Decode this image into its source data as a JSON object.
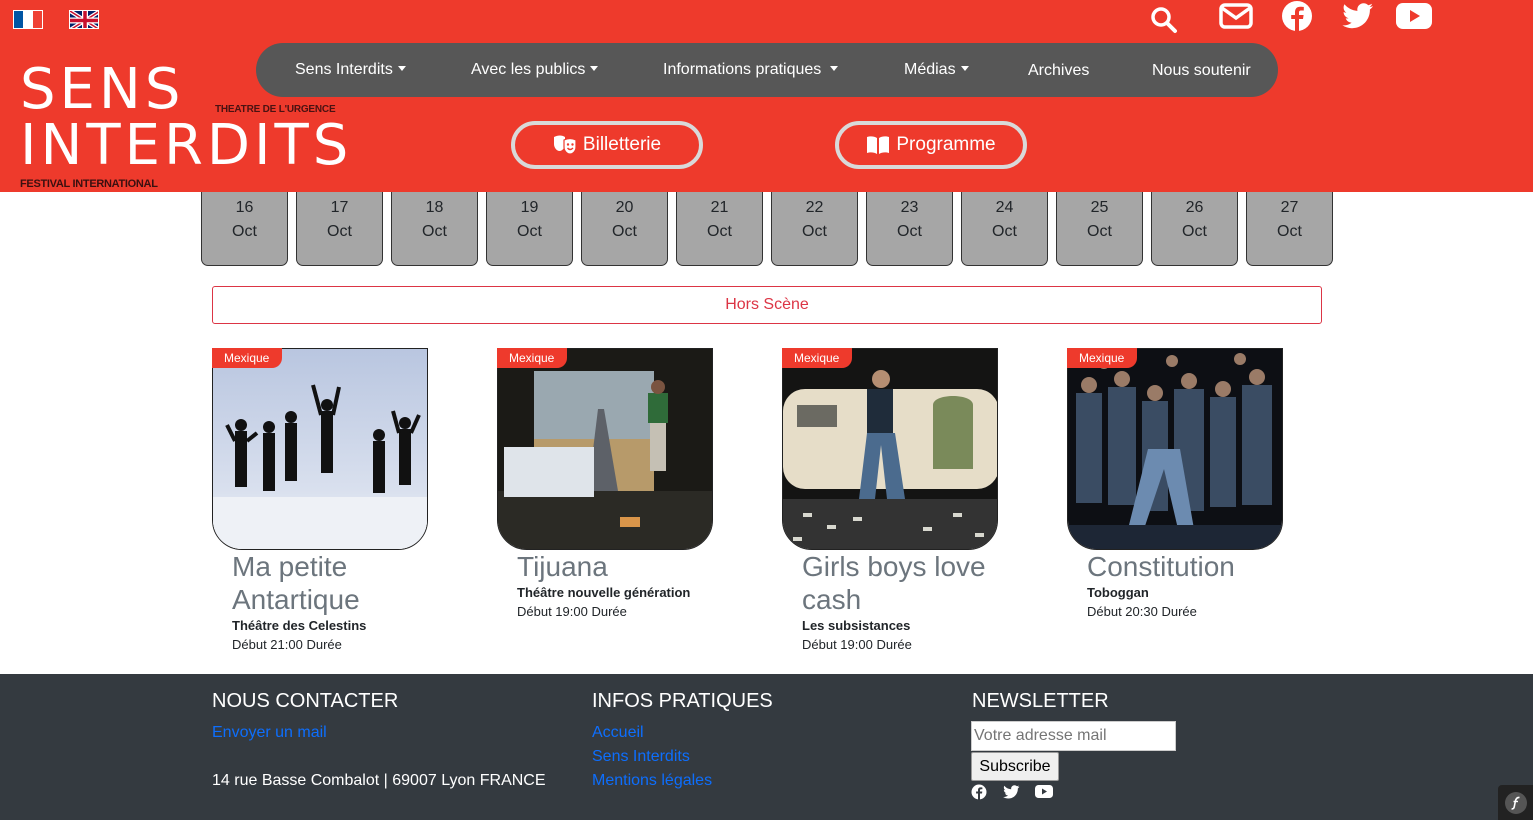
{
  "header": {
    "languages": [
      {
        "code": "fr",
        "icon": "flag-fr-icon"
      },
      {
        "code": "en",
        "icon": "flag-en-icon"
      }
    ],
    "top_icons": [
      "search-icon",
      "envelope-icon",
      "facebook-icon",
      "twitter-icon",
      "youtube-icon"
    ],
    "logo": {
      "line1": "SENS",
      "line2": "INTERDITS",
      "tagline": "THEATRE DE L'URGENCE",
      "subtitle": "FESTIVAL INTERNATIONAL"
    },
    "nav": [
      {
        "label": "Sens Interdits",
        "dropdown": true
      },
      {
        "label": "Avec les publics",
        "dropdown": true
      },
      {
        "label": "Informations pratiques",
        "dropdown": true
      },
      {
        "label": "Médias",
        "dropdown": true
      },
      {
        "label": "Archives",
        "dropdown": false
      },
      {
        "label": "Nous soutenir",
        "dropdown": false
      }
    ],
    "buttons": {
      "billetterie": "Billetterie",
      "programme": "Programme"
    },
    "colors": {
      "brand": "#ee3a2c",
      "nav": "#575757"
    }
  },
  "dates": [
    {
      "day": "16",
      "month": "Oct"
    },
    {
      "day": "17",
      "month": "Oct"
    },
    {
      "day": "18",
      "month": "Oct"
    },
    {
      "day": "19",
      "month": "Oct"
    },
    {
      "day": "20",
      "month": "Oct"
    },
    {
      "day": "21",
      "month": "Oct"
    },
    {
      "day": "22",
      "month": "Oct"
    },
    {
      "day": "23",
      "month": "Oct"
    },
    {
      "day": "24",
      "month": "Oct"
    },
    {
      "day": "25",
      "month": "Oct"
    },
    {
      "day": "26",
      "month": "Oct"
    },
    {
      "day": "27",
      "month": "Oct"
    }
  ],
  "hors_scene": "Hors Scène",
  "shows": [
    {
      "country": "Mexique",
      "title": "Ma petite Antartique",
      "venue": "Théâtre des Celestins",
      "time": "Début 21:00 Durée"
    },
    {
      "country": "Mexique",
      "title": "Tijuana",
      "venue": "Théâtre nouvelle génération",
      "time": "Début 19:00 Durée"
    },
    {
      "country": "Mexique",
      "title": "Girls boys love cash",
      "venue": "Les subsistances",
      "time": "Début 19:00 Durée"
    },
    {
      "country": "Mexique",
      "title": "Constitution",
      "venue": "Toboggan",
      "time": "Début 20:30 Durée"
    }
  ],
  "footer": {
    "contact": {
      "title": "NOUS CONTACTER",
      "mail_link": "Envoyer un mail",
      "address": "14 rue Basse Combalot | 69007 Lyon FRANCE"
    },
    "infos": {
      "title": "INFOS PRATIQUES",
      "links": [
        "Accueil",
        "Sens Interdits",
        "Mentions légales"
      ]
    },
    "newsletter": {
      "title": "NEWSLETTER",
      "placeholder": "Votre adresse mail",
      "button": "Subscribe",
      "social": [
        "facebook-icon",
        "twitter-icon",
        "youtube-icon"
      ]
    }
  }
}
